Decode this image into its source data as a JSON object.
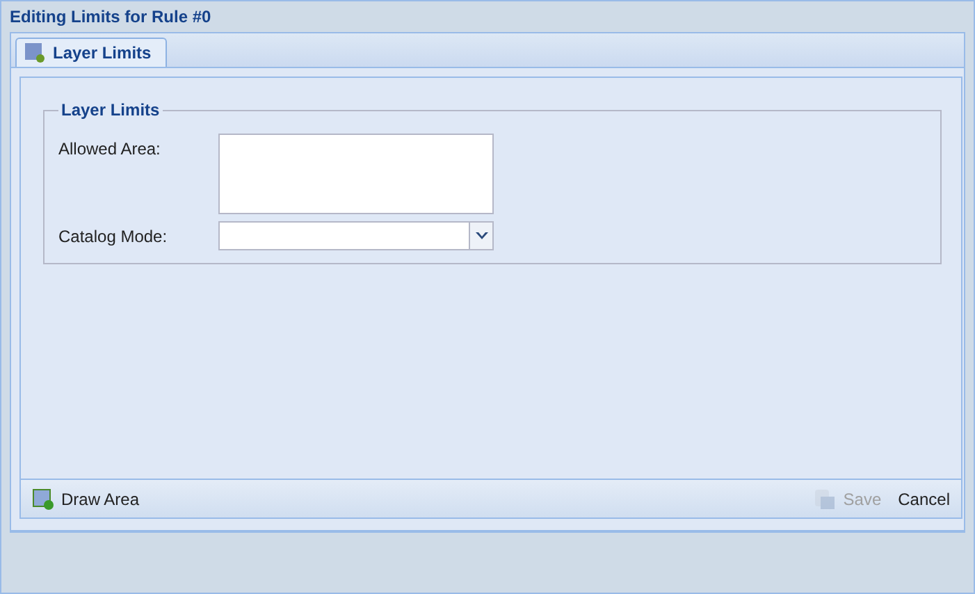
{
  "window": {
    "title": "Editing Limits for Rule #0"
  },
  "tabs": [
    {
      "label": "Layer Limits",
      "selected": true
    }
  ],
  "fieldset": {
    "legend": "Layer Limits",
    "fields": [
      {
        "kind": "textarea",
        "label": "Allowed Area:"
      },
      {
        "kind": "combo",
        "label": "Catalog Mode:"
      }
    ]
  },
  "toolbar": {
    "draw": "Draw Area",
    "save": {
      "label": "Save",
      "disabled": true
    },
    "cancel": "Cancel"
  }
}
